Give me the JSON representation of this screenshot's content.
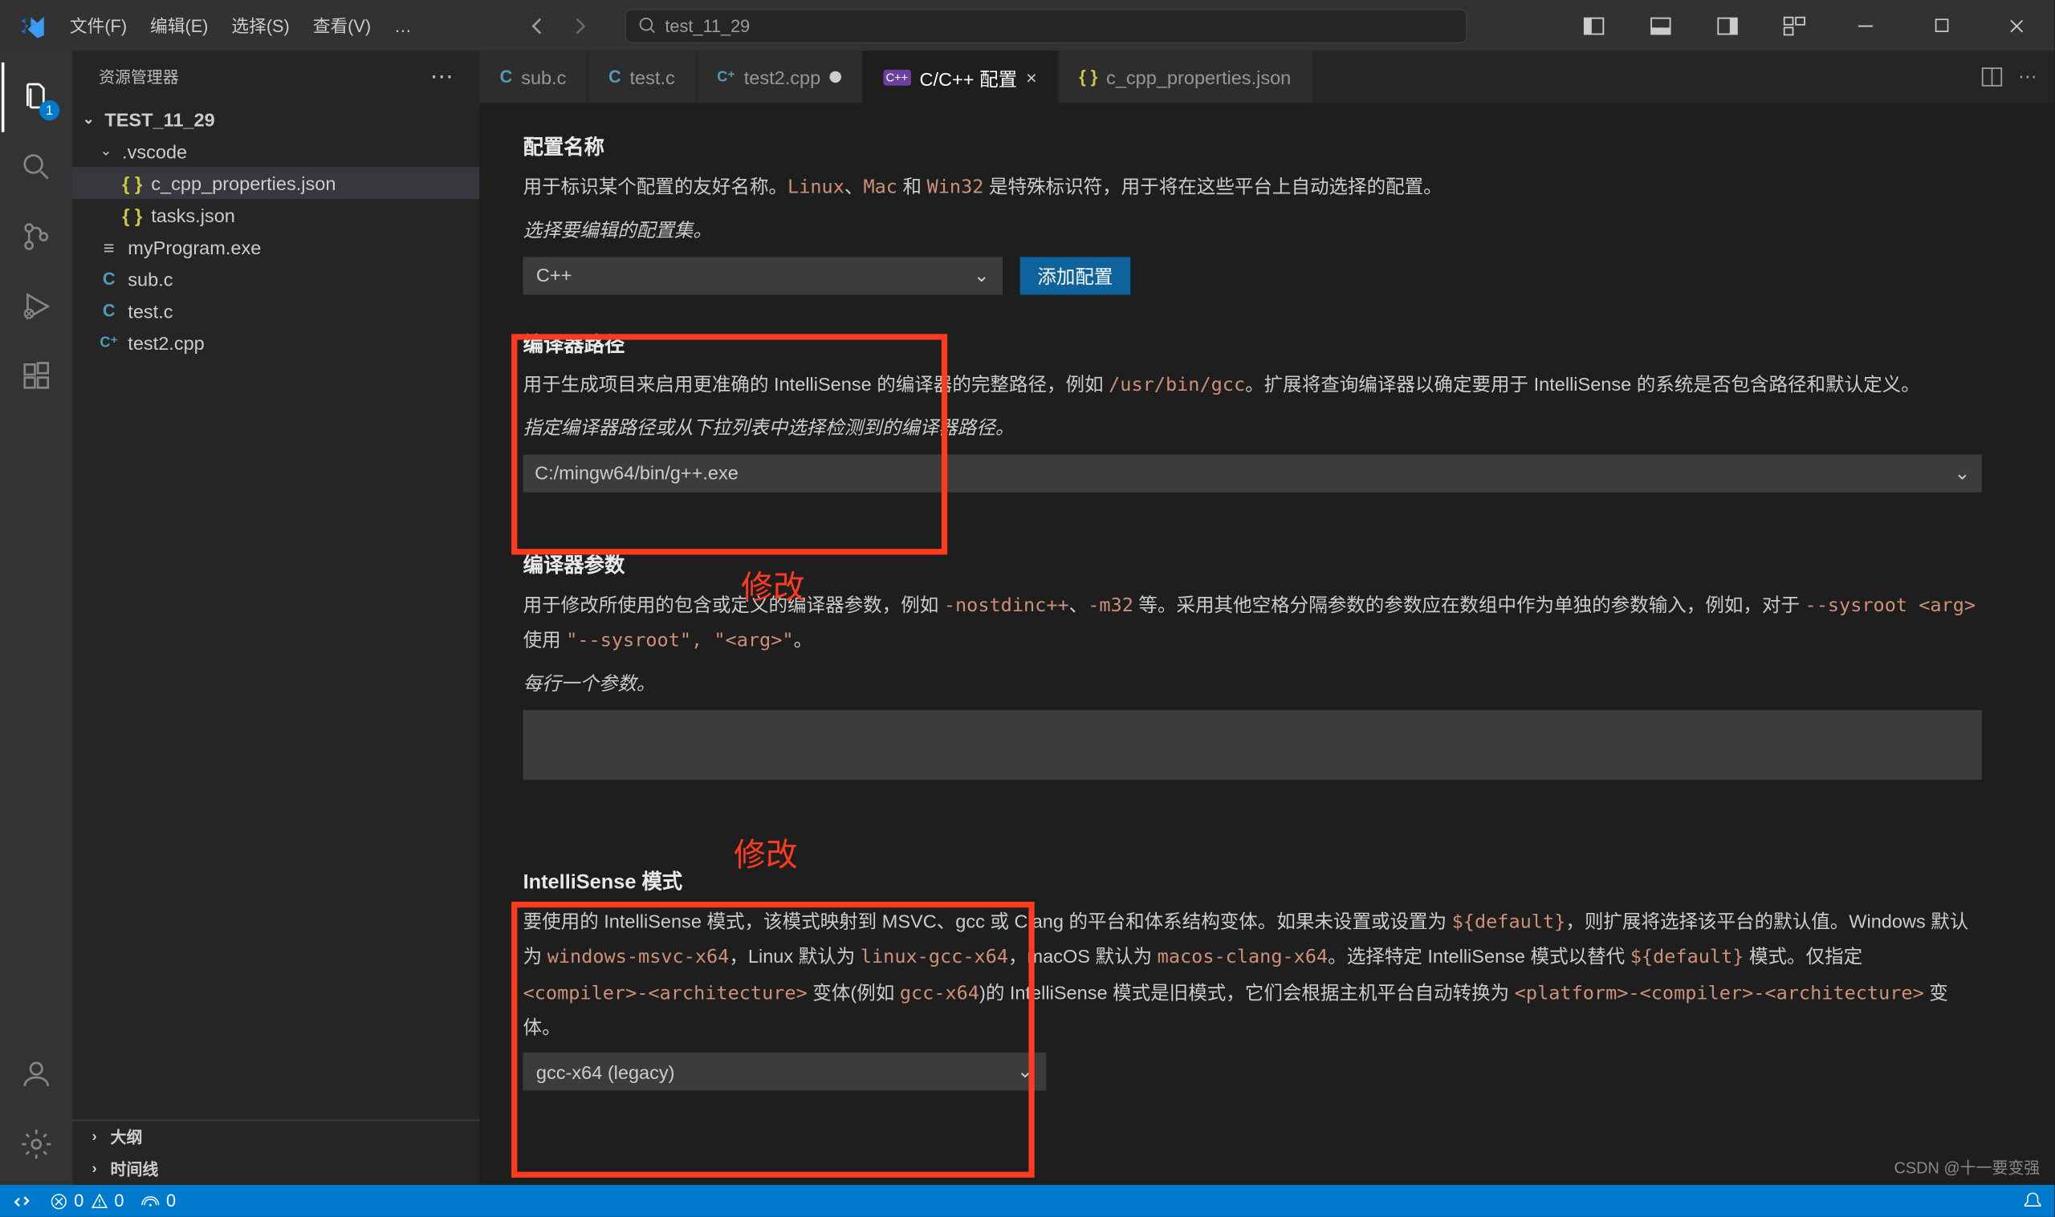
{
  "menu": {
    "file": "文件(F)",
    "edit": "编辑(E)",
    "select": "选择(S)",
    "view": "查看(V)",
    "more": "…"
  },
  "title_search": "test_11_29",
  "activity_badge": "1",
  "sidebar": {
    "title": "资源管理器",
    "root": "TEST_11_29",
    "vscode_folder": ".vscode",
    "files": {
      "ccpp": "c_cpp_properties.json",
      "tasks": "tasks.json",
      "exe": "myProgram.exe",
      "subc": "sub.c",
      "testc": "test.c",
      "test2": "test2.cpp"
    },
    "outline": "大纲",
    "timeline": "时间线"
  },
  "tabs": {
    "subc": "sub.c",
    "testc": "test.c",
    "test2": "test2.cpp",
    "config": "C/C++ 配置",
    "ccpp": "c_cpp_properties.json"
  },
  "config": {
    "name_title": "配置名称",
    "name_desc_1": "用于标识某个配置的友好名称。",
    "name_desc_2": "Linux",
    "name_desc_3": "、",
    "name_desc_4": "Mac",
    "name_desc_5": " 和 ",
    "name_desc_6": "Win32",
    "name_desc_7": " 是特殊标识符，用于将在这些平台上自动选择的配置。",
    "name_hint": "选择要编辑的配置集。",
    "name_select": "C++",
    "add_btn": "添加配置",
    "compiler_title": "编译器路径",
    "compiler_desc_a": "用于生成项目来启用更准确的 IntelliSense 的编译器的完整路径，例如 ",
    "compiler_code": "/usr/bin/gcc",
    "compiler_desc_b": "。扩展将查询编译器以确定要用于 IntelliSense 的系统是否包含路径和默认定义。",
    "compiler_hint": "指定编译器路径或从下拉列表中选择检测到的编译器路径。",
    "compiler_value": "C:/mingw64/bin/g++.exe",
    "args_title": "编译器参数",
    "args_desc_a": "用于修改所使用的包含或定义的编译器参数，例如 ",
    "args_code1": "-nostdinc++",
    "args_desc_b": "、",
    "args_code2": "-m32",
    "args_desc_c": " 等。采用其他空格分隔参数的参数应在数组中作为单独的参数输入，例如，对于 ",
    "args_code3": "--sysroot <arg>",
    "args_desc_d": " 使用 ",
    "args_code4": "\"--sysroot\", \"<arg>\"",
    "args_desc_e": "。",
    "args_hint": "每行一个参数。",
    "mode_title": "IntelliSense 模式",
    "mode_desc_a": "要使用的 IntelliSense 模式，该模式映射到 MSVC、gcc 或 Clang 的平台和体系结构变体。如果未设置或设置为 ",
    "mode_code1": "${default}",
    "mode_desc_b": "，则扩展将选择该平台的默认值。Windows 默认为 ",
    "mode_code2": "windows-msvc-x64",
    "mode_desc_c": "，Linux 默认为 ",
    "mode_code3": "linux-gcc-x64",
    "mode_desc_d": "，macOS 默认为 ",
    "mode_code4": "macos-clang-x64",
    "mode_desc_e": "。选择特定 IntelliSense 模式以替代 ",
    "mode_code5": "${default}",
    "mode_desc_f": " 模式。仅指定 ",
    "mode_code6": "<compiler>-<architecture>",
    "mode_desc_g": " 变体(例如 ",
    "mode_code7": "gcc-x64",
    "mode_desc_h": ")的 IntelliSense 模式是旧模式，它们会根据主机平台自动转换为 ",
    "mode_code8": "<platform>-<compiler>-<architecture>",
    "mode_desc_i": " 变体。",
    "mode_value": "gcc-x64 (legacy)",
    "annot_modify": "修改"
  },
  "status": {
    "errors": "0",
    "warnings": "0",
    "ports": "0"
  },
  "watermark": "CSDN @十一要变强"
}
